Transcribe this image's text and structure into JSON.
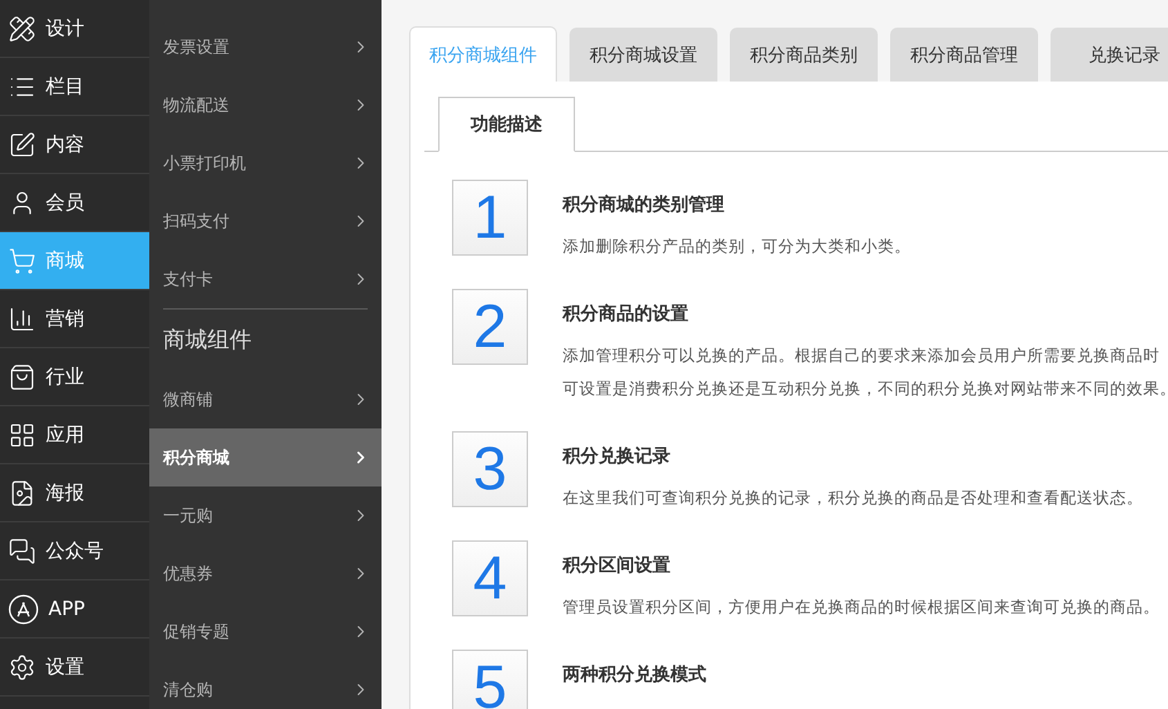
{
  "main_nav": [
    {
      "kind": "design",
      "label": "设计",
      "selected": false
    },
    {
      "kind": "columns",
      "label": "栏目",
      "selected": false
    },
    {
      "kind": "content",
      "label": "内容",
      "selected": false
    },
    {
      "kind": "member",
      "label": "会员",
      "selected": false
    },
    {
      "kind": "mall",
      "label": "商城",
      "selected": true
    },
    {
      "kind": "marketing",
      "label": "营销",
      "selected": false
    },
    {
      "kind": "industry",
      "label": "行业",
      "selected": false
    },
    {
      "kind": "apps",
      "label": "应用",
      "selected": false
    },
    {
      "kind": "poster",
      "label": "海报",
      "selected": false
    },
    {
      "kind": "wechat",
      "label": "公众号",
      "selected": false
    },
    {
      "kind": "app",
      "label": "APP",
      "selected": false
    },
    {
      "kind": "settings",
      "label": "设置",
      "selected": false
    }
  ],
  "sub_nav": [
    {
      "kind": "item",
      "label": "发票设置",
      "selected": false
    },
    {
      "kind": "item",
      "label": "物流配送",
      "selected": false
    },
    {
      "kind": "item",
      "label": "小票打印机",
      "selected": false
    },
    {
      "kind": "item",
      "label": "扫码支付",
      "selected": false
    },
    {
      "kind": "item",
      "label": "支付卡",
      "selected": false
    },
    {
      "kind": "heading",
      "label": "商城组件"
    },
    {
      "kind": "item",
      "label": "微商铺",
      "selected": false
    },
    {
      "kind": "item",
      "label": "积分商城",
      "selected": true
    },
    {
      "kind": "item",
      "label": "一元购",
      "selected": false
    },
    {
      "kind": "item",
      "label": "优惠券",
      "selected": false
    },
    {
      "kind": "item",
      "label": "促销专题",
      "selected": false
    },
    {
      "kind": "item",
      "label": "清仓购",
      "selected": false
    }
  ],
  "tabs": [
    {
      "label": "积分商城组件",
      "selected": true
    },
    {
      "label": "积分商城设置",
      "selected": false
    },
    {
      "label": "积分商品类别",
      "selected": false
    },
    {
      "label": "积分商品管理",
      "selected": false
    },
    {
      "label": "兑换记录",
      "selected": false
    }
  ],
  "inner_tabs": [
    {
      "label": "功能描述",
      "selected": true
    }
  ],
  "features": [
    {
      "number": "1",
      "title": "积分商城的类别管理",
      "lines": [
        "添加删除积分产品的类别，可分为大类和小类。"
      ]
    },
    {
      "number": "2",
      "title": "积分商品的设置",
      "lines": [
        "添加管理积分可以兑换的产品。根据自己的要求来添加会员用户所需要兑换商品时",
        "可设置是消费积分兑换还是互动积分兑换，不同的积分兑换对网站带来不同的效果。"
      ]
    },
    {
      "number": "3",
      "title": "积分兑换记录",
      "lines": [
        "在这里我们可查询积分兑换的记录，积分兑换的商品是否处理和查看配送状态。"
      ]
    },
    {
      "number": "4",
      "title": "积分区间设置",
      "lines": [
        "管理员设置积分区间，方便用户在兑换商品的时候根据区间来查询可兑换的商品。"
      ]
    },
    {
      "number": "5",
      "title": "两种积分兑换模式"
    }
  ]
}
